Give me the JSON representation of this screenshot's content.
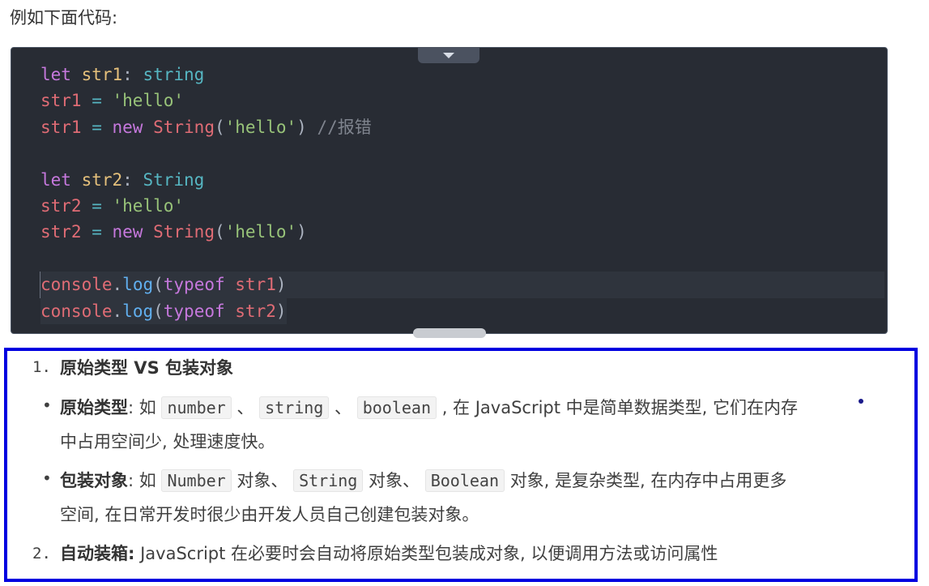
{
  "intro": "例如下面代码:",
  "code": {
    "lines": [
      [
        {
          "t": "let",
          "c": "kw"
        },
        {
          "t": " ",
          "c": "pun"
        },
        {
          "t": "str1",
          "c": "var"
        },
        {
          "t": ": ",
          "c": "pun"
        },
        {
          "t": "string",
          "c": "type"
        }
      ],
      [
        {
          "t": "str1",
          "c": "id"
        },
        {
          "t": " = ",
          "c": "type"
        },
        {
          "t": "'hello'",
          "c": "str"
        }
      ],
      [
        {
          "t": "str1",
          "c": "id"
        },
        {
          "t": " = ",
          "c": "type"
        },
        {
          "t": "new",
          "c": "kw"
        },
        {
          "t": " ",
          "c": "pun"
        },
        {
          "t": "String",
          "c": "cls"
        },
        {
          "t": "(",
          "c": "pun"
        },
        {
          "t": "'hello'",
          "c": "str"
        },
        {
          "t": ") ",
          "c": "pun"
        },
        {
          "t": "//报错",
          "c": "cm"
        }
      ],
      [],
      [
        {
          "t": "let",
          "c": "kw"
        },
        {
          "t": " ",
          "c": "pun"
        },
        {
          "t": "str2",
          "c": "var"
        },
        {
          "t": ": ",
          "c": "pun"
        },
        {
          "t": "String",
          "c": "type"
        }
      ],
      [
        {
          "t": "str2",
          "c": "id"
        },
        {
          "t": " = ",
          "c": "type"
        },
        {
          "t": "'hello'",
          "c": "str"
        }
      ],
      [
        {
          "t": "str2",
          "c": "id"
        },
        {
          "t": " = ",
          "c": "type"
        },
        {
          "t": "new",
          "c": "kw"
        },
        {
          "t": " ",
          "c": "pun"
        },
        {
          "t": "String",
          "c": "cls"
        },
        {
          "t": "(",
          "c": "pun"
        },
        {
          "t": "'hello'",
          "c": "str"
        },
        {
          "t": ")",
          "c": "pun"
        }
      ],
      [],
      [
        {
          "t": "console",
          "c": "id"
        },
        {
          "t": ".",
          "c": "pun"
        },
        {
          "t": "log",
          "c": "fn"
        },
        {
          "t": "(",
          "c": "pun"
        },
        {
          "t": "typeof",
          "c": "kw"
        },
        {
          "t": " ",
          "c": "pun"
        },
        {
          "t": "str1",
          "c": "id"
        },
        {
          "t": ")",
          "c": "pun"
        }
      ],
      [
        {
          "t": "console",
          "c": "id"
        },
        {
          "t": ".",
          "c": "pun"
        },
        {
          "t": "log",
          "c": "fn"
        },
        {
          "t": "(",
          "c": "pun"
        },
        {
          "t": "typeof",
          "c": "kw"
        },
        {
          "t": " ",
          "c": "pun"
        },
        {
          "t": "str2",
          "c": "id"
        },
        {
          "t": ")",
          "c": "pun"
        }
      ]
    ]
  },
  "list": {
    "item1_num": "1.",
    "item1_title": "原始类型 VS 包装对象",
    "bullet": "•",
    "b1_label": "原始类型",
    "b1_colon": ": 如",
    "b1_code1": "number",
    "b1_sep1": "、",
    "b1_code2": "string",
    "b1_sep2": "、",
    "b1_code3": "boolean",
    "b1_rest": ", 在 JavaScript 中是简单数据类型, 它们在内存",
    "b1_line2": "中占用空间少, 处理速度快。",
    "b2_label": "包装对象",
    "b2_colon": ": 如",
    "b2_code1": "Number",
    "b2_mid1": "对象、",
    "b2_code2": "String",
    "b2_mid2": "对象、",
    "b2_code3": "Boolean",
    "b2_rest": "对象, 是复杂类型, 在内存中占用更多",
    "b2_line2": "空间, 在日常开发时很少由开发人员自己创建包装对象。",
    "item2_num": "2.",
    "item2_label": "自动装箱:",
    "item2_text": "JavaScript 在必要时会自动将原始类型包装成对象, 以便调用方法或访问属性"
  }
}
